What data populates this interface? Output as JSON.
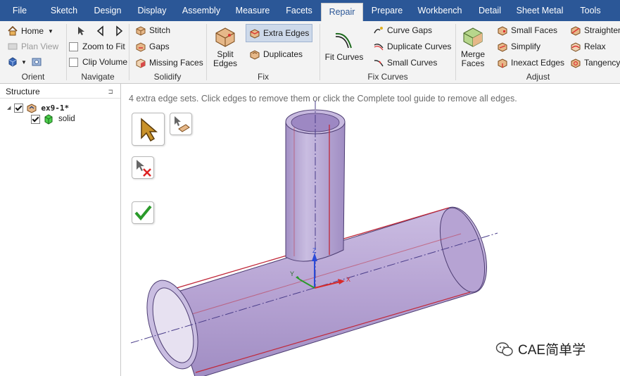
{
  "menu": {
    "tabs": [
      "File",
      "Sketch",
      "Design",
      "Display",
      "Assembly",
      "Measure",
      "Facets",
      "Repair",
      "Prepare",
      "Workbench",
      "Detail",
      "Sheet Metal",
      "Tools"
    ],
    "active": "Repair"
  },
  "ribbon": {
    "orient": {
      "label": "Orient",
      "home": "Home",
      "plan_view": "Plan View"
    },
    "navigate": {
      "label": "Navigate",
      "zoom_to_fit": "Zoom to Fit",
      "clip_volume": "Clip Volume"
    },
    "solidify": {
      "label": "Solidify",
      "stitch": "Stitch",
      "gaps": "Gaps",
      "missing_faces": "Missing Faces"
    },
    "fix": {
      "label": "Fix",
      "split_edges": "Split\nEdges",
      "extra_edges": "Extra Edges",
      "duplicates": "Duplicates"
    },
    "fix_curves": {
      "label": "Fix Curves",
      "fit_curves": "Fit Curves",
      "curve_gaps": "Curve Gaps",
      "duplicate_curves": "Duplicate Curves",
      "small_curves": "Small Curves"
    },
    "adjust": {
      "label": "Adjust",
      "merge_faces": "Merge\nFaces",
      "small_faces": "Small Faces",
      "simplify": "Simplify",
      "inexact_edges": "Inexact Edges",
      "straighten": "Straighten",
      "relax": "Relax",
      "tangency": "Tangency"
    }
  },
  "structure": {
    "title": "Structure",
    "pin_glyph": "⊐",
    "root": "ex9-1*",
    "child": "solid",
    "expand_glyph": "◢"
  },
  "viewport": {
    "hint": "4 extra edge sets. Click edges to remove them or click the Complete tool guide to remove all edges.",
    "axis_x": "X",
    "axis_y": "Y",
    "axis_z": "Z"
  },
  "watermark": {
    "text": "CAE简单学"
  },
  "colors": {
    "menubar": "#2b5797",
    "pipe_fill": "#b8a6d4",
    "pipe_dark": "#8f7cb4",
    "edge_red": "#c0283a",
    "axis_line": "#4a3d8a"
  }
}
